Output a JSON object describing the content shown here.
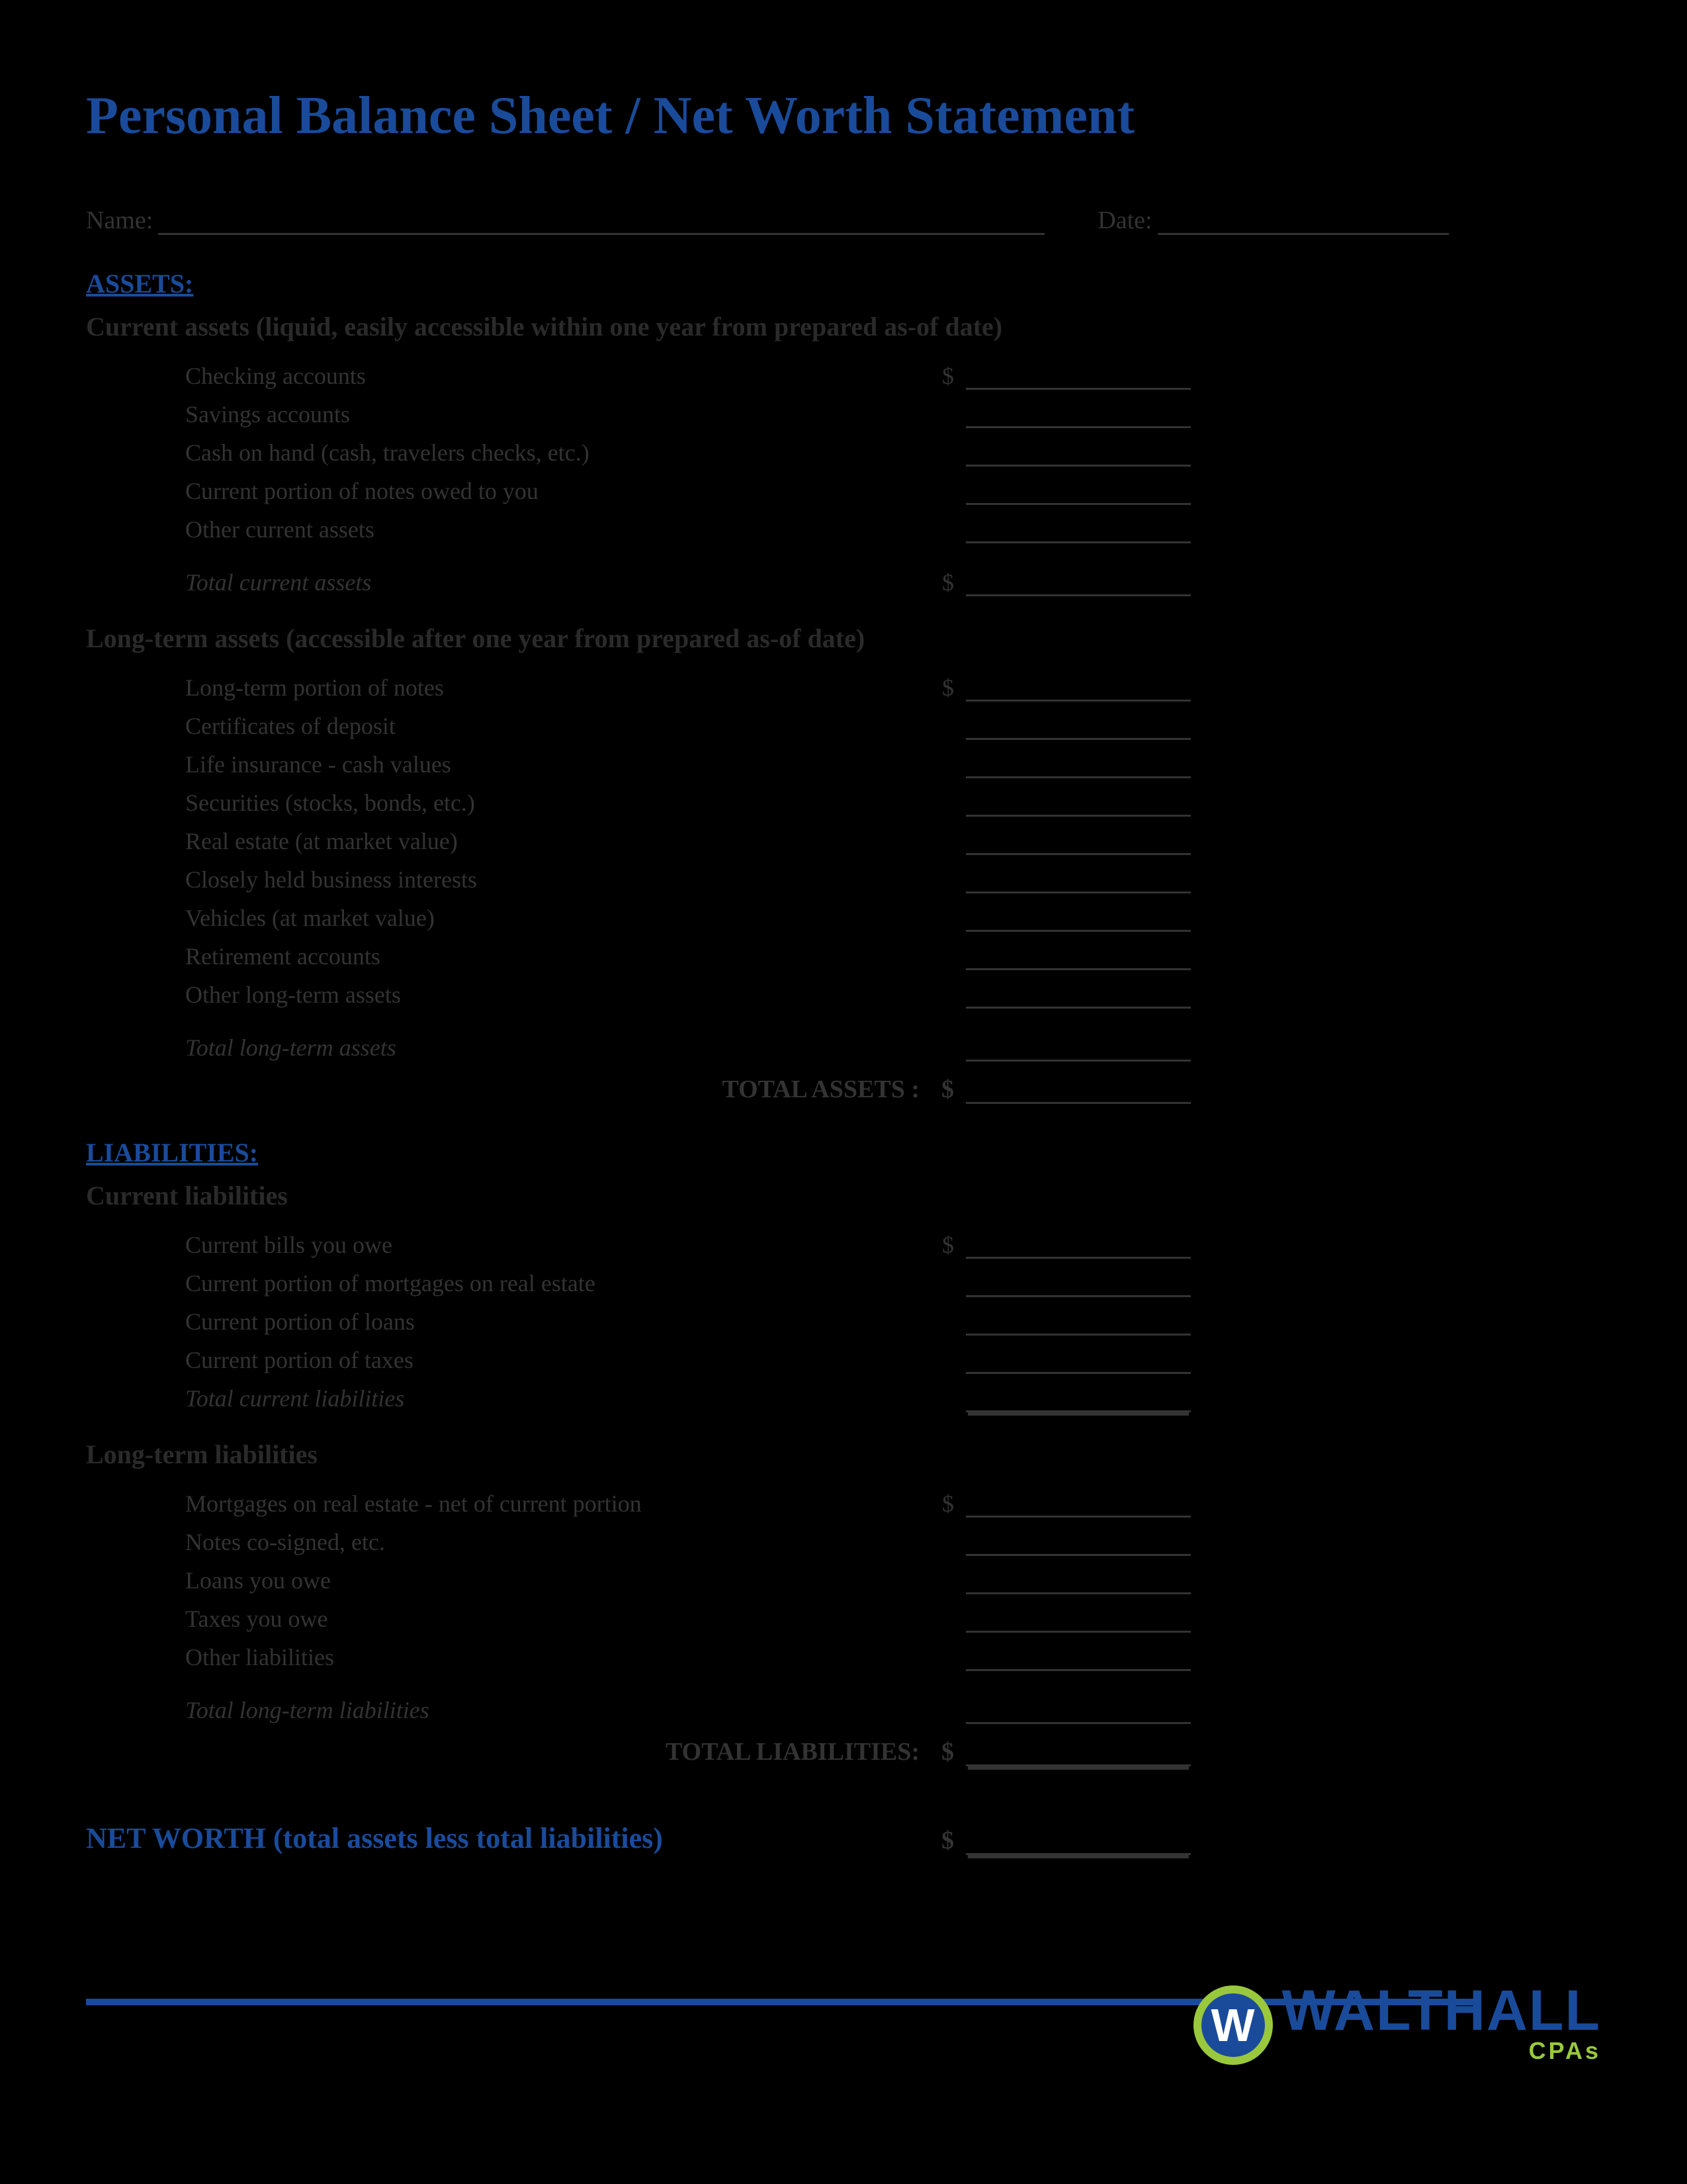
{
  "title": "Personal Balance Sheet / Net Worth Statement",
  "header": {
    "name_label": "Name:",
    "date_label": "Date:"
  },
  "assets": {
    "heading": "ASSETS:",
    "current": {
      "heading": "Current assets (liquid, easily accessible within one year from prepared as-of date)",
      "items": [
        "Checking accounts",
        "Savings accounts",
        "Cash on hand (cash, travelers checks, etc.)",
        "Current portion of notes owed to you",
        "Other current assets"
      ],
      "total_label": "Total current assets"
    },
    "longterm": {
      "heading": "Long-term assets (accessible after one year from prepared as-of date)",
      "items": [
        "Long-term portion of notes",
        "Certificates of deposit",
        "Life insurance - cash values",
        "Securities (stocks, bonds, etc.)",
        "Real estate (at market value)",
        "Closely held business interests",
        "Vehicles (at market value)",
        "Retirement accounts",
        "Other long-term assets"
      ],
      "total_label": "Total long-term assets"
    },
    "grand_total_label": "TOTAL ASSETS :"
  },
  "liabilities": {
    "heading": "LIABILITIES:",
    "current": {
      "heading": "Current liabilities",
      "items": [
        "Current bills you owe",
        "Current portion of mortgages on real estate",
        "Current portion of loans",
        "Current portion of taxes"
      ],
      "total_label": "Total current liabilities"
    },
    "longterm": {
      "heading": "Long-term liabilities",
      "items": [
        "Mortgages on real estate - net of current portion",
        "Notes co-signed, etc.",
        "Loans you owe",
        "Taxes you owe",
        "Other liabilities"
      ],
      "total_label": "Total long-term liabilities"
    },
    "grand_total_label": "TOTAL LIABILITIES:"
  },
  "networth_label": "NET WORTH (total assets less total liabilities)",
  "dollar": "$",
  "logo": {
    "mark": "W",
    "text1": "WALTHALL",
    "text2": "CPAs"
  }
}
